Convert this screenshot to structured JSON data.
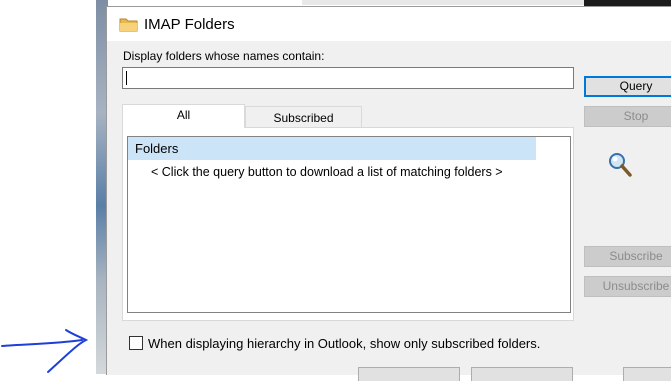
{
  "dialog": {
    "title": "IMAP Folders",
    "contains_label": "Display folders whose names contain:",
    "search_value": "",
    "buttons": {
      "query": "Query",
      "stop": "Stop",
      "subscribe": "Subscribe",
      "unsubscribe": "Unsubscribe"
    },
    "tabs": [
      {
        "label": "All",
        "selected": true
      },
      {
        "label": "Subscribed",
        "selected": false
      }
    ],
    "tree": {
      "root": "Folders",
      "hint": "< Click the query button to download a list of matching folders >"
    },
    "checkbox": {
      "label": "When displaying hierarchy in Outlook, show only subscribed folders.",
      "checked": false
    }
  },
  "colors": {
    "accent": "#0078d7",
    "selection": "#cce4f7",
    "annotation": "#1e3fd8"
  },
  "icons": [
    "folder-icon",
    "search-animation-icon",
    "annotation-arrow"
  ]
}
